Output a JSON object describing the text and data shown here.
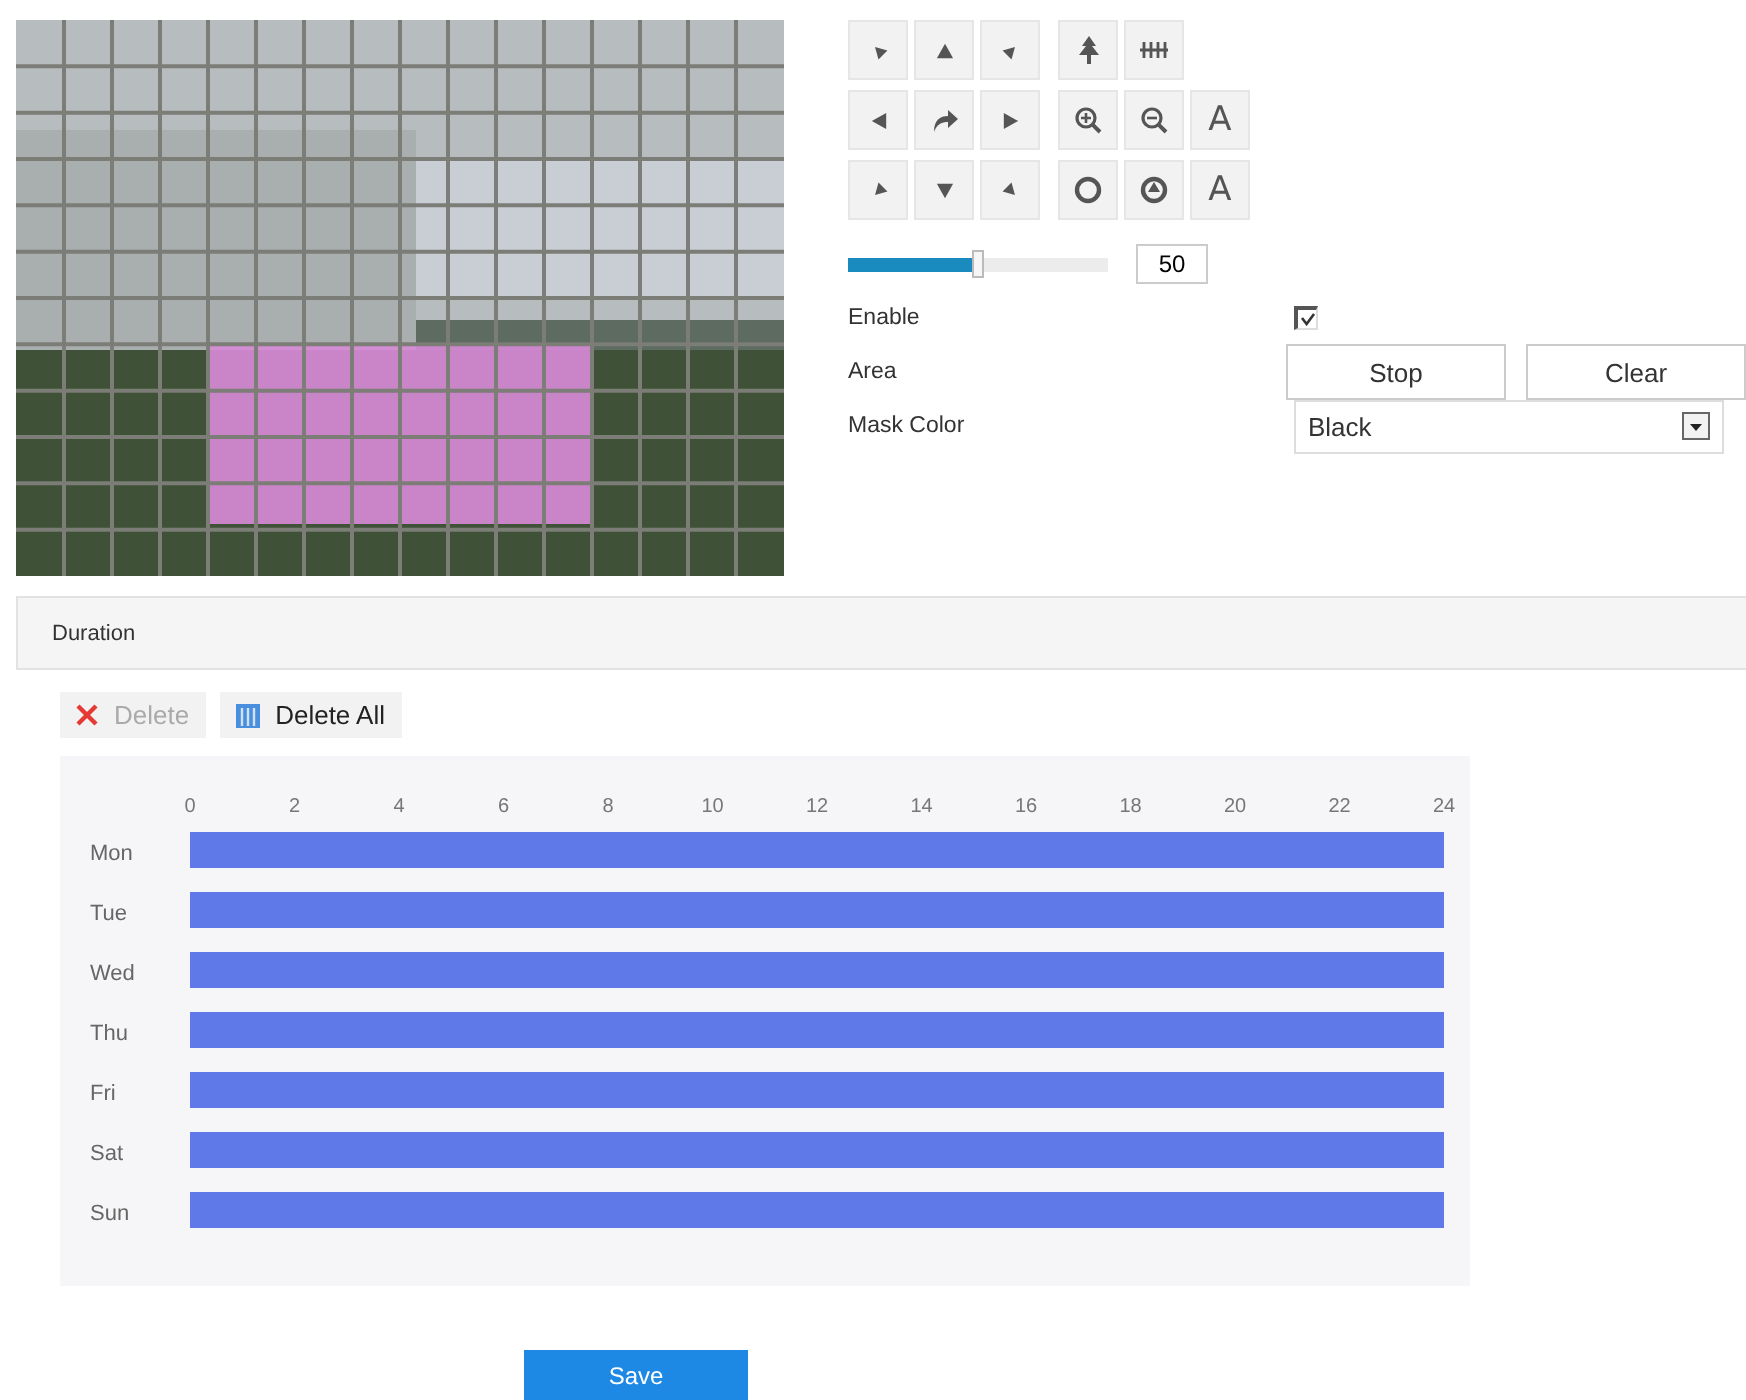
{
  "ptz": {
    "rows": [
      [
        {
          "kind": "up-left"
        },
        {
          "kind": "up"
        },
        {
          "kind": "up-right"
        },
        {
          "kind": "tree"
        },
        {
          "kind": "bars"
        }
      ],
      [
        {
          "kind": "left"
        },
        {
          "kind": "rotate"
        },
        {
          "kind": "right"
        },
        {
          "kind": "zoom-in"
        },
        {
          "kind": "zoom-out"
        },
        {
          "kind": "text",
          "label": "A"
        }
      ],
      [
        {
          "kind": "down-left"
        },
        {
          "kind": "down"
        },
        {
          "kind": "down-right"
        },
        {
          "kind": "iris-close"
        },
        {
          "kind": "iris-open"
        },
        {
          "kind": "text",
          "label": "A"
        }
      ]
    ],
    "speed": {
      "level": 0.5,
      "value": "50"
    }
  },
  "settings": {
    "enable": {
      "label": "Enable",
      "checked": true
    },
    "area": {
      "label": "Area",
      "buttons": [
        "Stop",
        "Clear"
      ]
    },
    "mask_color": {
      "label": "Mask Color",
      "value": "Black"
    }
  },
  "duration": {
    "title": "Duration",
    "toolbar": [
      {
        "kind": "delete",
        "label": "Delete",
        "disabled": true
      },
      {
        "kind": "delete-all",
        "label": "Delete All",
        "disabled": false
      }
    ],
    "chart_data": {
      "type": "bar",
      "orientation": "horizontal",
      "categories": [
        "Mon",
        "Tue",
        "Wed",
        "Thu",
        "Fri",
        "Sat",
        "Sun"
      ],
      "series": [
        {
          "color": "#5f7ae8",
          "values": [
            24,
            24,
            24,
            24,
            24,
            24,
            24
          ]
        }
      ],
      "xlim": [
        0,
        24
      ],
      "xticks": [
        0,
        2,
        4,
        6,
        8,
        10,
        12,
        14,
        16,
        18,
        20,
        22,
        24
      ]
    }
  },
  "save_button": "Save"
}
